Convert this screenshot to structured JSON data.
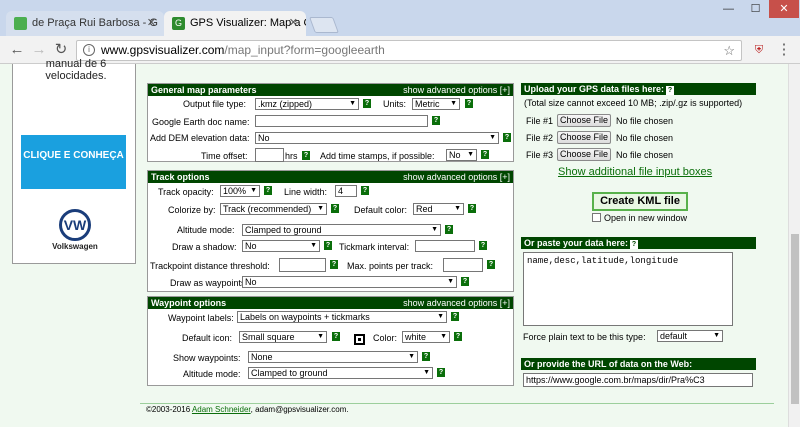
{
  "browser": {
    "tab1_title": "de Praça Rui Barbosa - G",
    "tab2_title": "GPS Visualizer: Map a GP",
    "url_host": "www.gpsvisualizer.com",
    "url_path": "/map_input?form=googleearth",
    "minimize": "—",
    "maximize": "☐",
    "close": "✕"
  },
  "ad": {
    "text": "manual de 6 velocidades.",
    "button": "CLIQUE E CONHEÇA",
    "logo": "VW",
    "brand": "Volkswagen"
  },
  "general": {
    "title": "General map parameters",
    "advanced": "show advanced options [+]",
    "output_label": "Output file type:",
    "output_value": ".kmz (zipped)",
    "units_label": "Units:",
    "units_value": "Metric",
    "docname_label": "Google Earth doc name:",
    "dem_label": "Add DEM elevation data:",
    "dem_value": "No",
    "offset_label": "Time offset:",
    "hrs": "hrs",
    "stamps_label": "Add time stamps, if possible:",
    "stamps_value": "No"
  },
  "track": {
    "title": "Track options",
    "advanced": "show advanced options [+]",
    "opacity_label": "Track opacity:",
    "opacity_value": "100%",
    "width_label": "Line width:",
    "width_value": "4",
    "colorize_label": "Colorize by:",
    "colorize_value": "Track (recommended)",
    "color_label": "Default color:",
    "color_value": "Red",
    "alt_label": "Altitude mode:",
    "alt_value": "Clamped to ground",
    "shadow_label": "Draw a shadow:",
    "shadow_value": "No",
    "tick_label": "Tickmark interval:",
    "thresh_label": "Trackpoint distance threshold:",
    "maxpts_label": "Max. points per track:",
    "waypts_label": "Draw as waypoints:",
    "waypts_value": "No"
  },
  "waypoint": {
    "title": "Waypoint options",
    "advanced": "show advanced options [+]",
    "labels_label": "Waypoint labels:",
    "labels_value": "Labels on waypoints + tickmarks",
    "icon_label": "Default icon:",
    "icon_value": "Small square",
    "color_label": "Color:",
    "color_value": "white",
    "show_label": "Show waypoints:",
    "show_value": "None",
    "alt_label": "Altitude mode:",
    "alt_value": "Clamped to ground"
  },
  "upload": {
    "title": "Upload your GPS data files here:",
    "note": "(Total size cannot exceed 10 MB; .zip/.gz is supported)",
    "file1": "File #1",
    "file2": "File #2",
    "file3": "File #3",
    "choose": "Choose File",
    "nofile": "No file chosen",
    "more_link": "Show additional file input boxes",
    "create": "Create KML file",
    "newwin": "Open in new window"
  },
  "paste": {
    "title": "Or paste your data here:",
    "content": "name,desc,latitude,longitude",
    "force_label": "Force plain text to be this type:",
    "force_value": "default"
  },
  "urlbox": {
    "title": "Or provide the URL of data on the Web:",
    "value": "https://www.google.com.br/maps/dir/Pra%C3"
  },
  "footer": {
    "copy": "©2003-2016",
    "author": "Adam Schneider",
    "email": ", adam@gpsvisualizer.com."
  },
  "help_glyph": "?",
  "arrow_glyph": "▼"
}
